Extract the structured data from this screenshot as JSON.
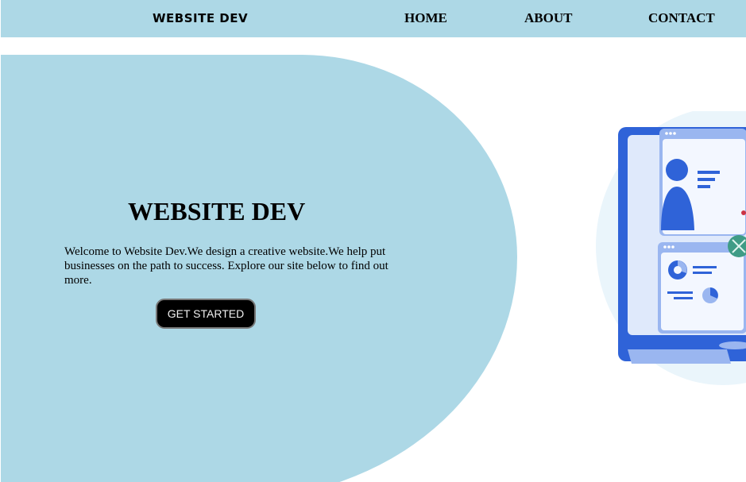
{
  "nav": {
    "logo": "WEBSITE DEV",
    "links": [
      "HOME",
      "ABOUT",
      "CONTACT"
    ]
  },
  "hero": {
    "title": "WEBSITE DEV",
    "text": "Welcome to Website Dev.We design a creative website.We help put businesses on the path to success. Explore our site below to find out more.",
    "button_label": "GET STARTED"
  },
  "colors": {
    "accent": "#add8e6",
    "button_bg": "#000000",
    "illustration_blue": "#2f63d8"
  },
  "icons": {
    "illustration": "computer-dashboard-illustration"
  }
}
